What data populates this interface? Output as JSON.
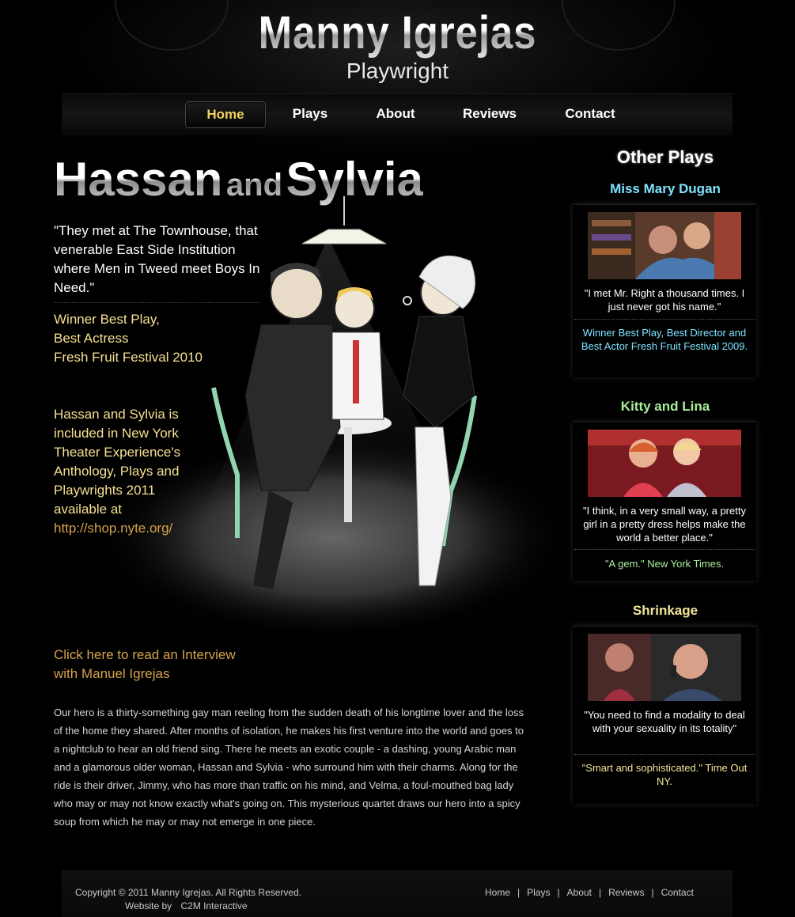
{
  "header": {
    "title": "Manny Igrejas",
    "subtitle": "Playwright"
  },
  "nav": [
    {
      "label": "Home",
      "active": true
    },
    {
      "label": "Plays",
      "active": false
    },
    {
      "label": "About",
      "active": false
    },
    {
      "label": "Reviews",
      "active": false
    },
    {
      "label": "Contact",
      "active": false
    }
  ],
  "main": {
    "title_part1": "Hassan",
    "title_and": "and",
    "title_part2": "Sylvia",
    "quote": "\"They met at The Townhouse, that venerable East Side Institution where Men in Tweed meet Boys In Need.\"",
    "award_line1": "Winner Best Play,",
    "award_line2": "Best Actress",
    "award_line3": "Fresh Fruit Festival 2010",
    "anthology": "Hassan and Sylvia is included in New York Theater Experience's Anthology, Plays and Playwrights 2011 available at",
    "anthology_link": "http://shop.nyte.org/",
    "interview_line1": "Click here to read an Interview",
    "interview_line2": "with Manuel Igrejas",
    "synopsis": "Our hero is a thirty-something gay man reeling from the sudden death of his longtime lover and the loss of the home they shared. After months of isolation, he makes his first venture into the world and goes to a nightclub to hear an old friend sing. There he meets an exotic couple - a dashing, young Arabic man and a glamorous older woman, Hassan and Sylvia - who surround him with their charms. Along for the ride is their driver, Jimmy, who has more than traffic on his mind, and Velma, a foul-mouthed bag lady who may or may not know exactly what's going on. This mysterious quartet draws our hero into a spicy soup from which he may or may not emerge in one piece."
  },
  "sidebar": {
    "heading": "Other Plays",
    "plays": [
      {
        "title": "Miss Mary Dugan",
        "title_color": "#7fe3ff",
        "quote": "\"I met Mr. Right a thousand times. I just never got his name.\"",
        "note": "Winner Best Play, Best Director and Best Actor Fresh Fruit Festival 2009.",
        "note_color": "#7fe3ff"
      },
      {
        "title": "Kitty and Lina",
        "title_color": "#a8f09a",
        "quote": "\"I think, in a very small way, a pretty girl in a pretty dress helps make the world a better place.\"",
        "note": "\"A gem.\" New York Times.",
        "note_color": "#a8f09a"
      },
      {
        "title": "Shrinkage",
        "title_color": "#f3e79a",
        "quote": "\"You need to find a modality to deal with your sexuality in its totality\"",
        "note": "\"Smart and sophisticated.\" Time Out NY.",
        "note_color": "#f3e79a"
      }
    ]
  },
  "footer": {
    "copyright": "Copyright © 2011 Manny Igrejas. All Rights Reserved.",
    "website_by": "Website by",
    "website_company": "C2M Interactive",
    "links": [
      "Home",
      "Plays",
      "About",
      "Reviews",
      "Contact"
    ],
    "separator": "|"
  }
}
